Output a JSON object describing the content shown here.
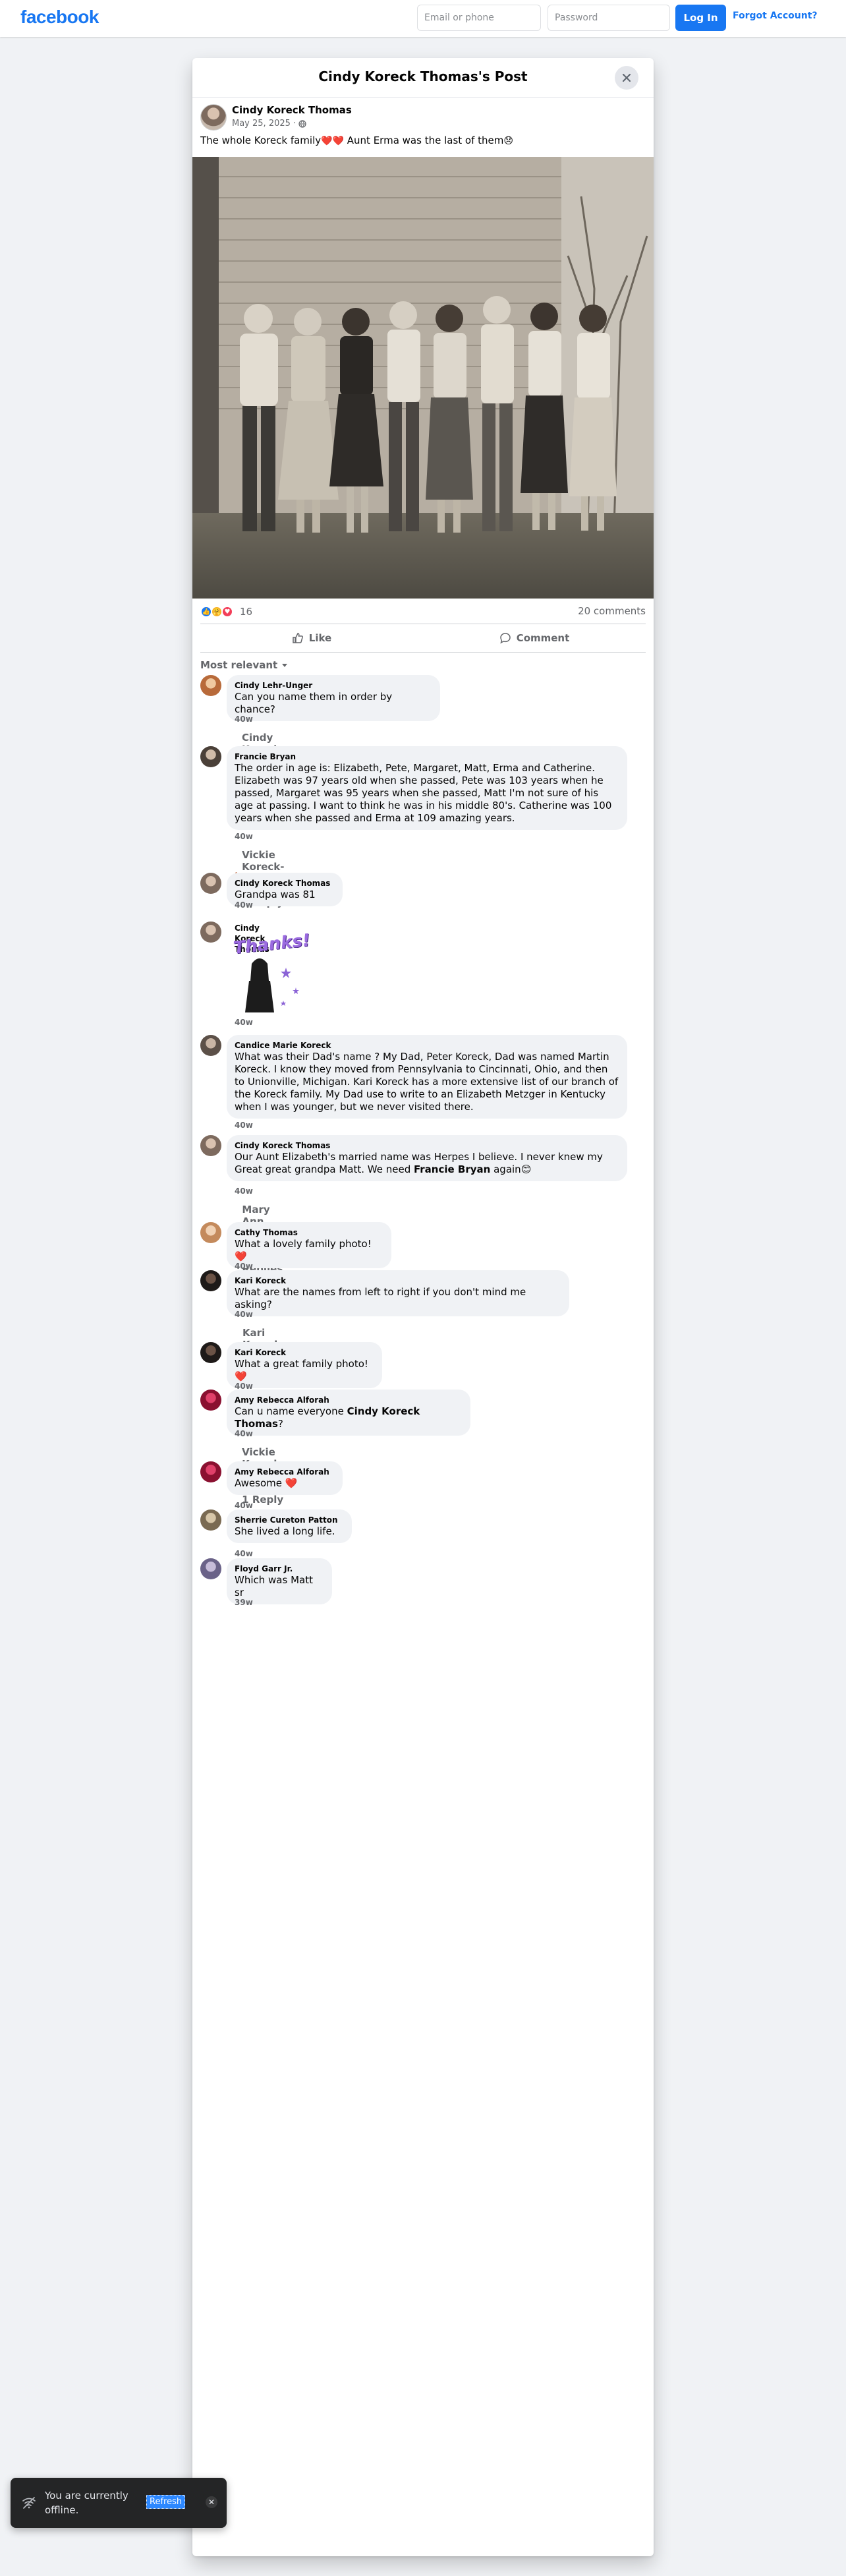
{
  "topbar": {
    "logo": "facebook",
    "email_placeholder": "Email or phone",
    "password_placeholder": "Password",
    "login_label": "Log In",
    "forgot_label": "Forgot Account?"
  },
  "dialog": {
    "title": "Cindy Koreck Thomas's Post",
    "close_icon": "close-icon"
  },
  "post": {
    "author": "Cindy Koreck Thomas",
    "date": "May 25, 2025",
    "audience_icon": "globe-icon",
    "text": "The whole Koreck family",
    "text_emojis": "❤️❤️",
    "text_tail": "Aunt Erma was the last of them",
    "text_tail_emoji": "😞",
    "reaction_count": "16",
    "comments_count": "20 comments",
    "like_label": "Like",
    "comment_label": "Comment",
    "sort_label": "Most relevant"
  },
  "comments": [
    {
      "name": "Cindy Lehr-Unger",
      "text": "Can you name them in order by chance?",
      "time": "40w",
      "reply": "Cindy Koreck Thomas replied · 1 Reply"
    },
    {
      "name": "Francie Bryan",
      "text": "The order in age is: Elizabeth, Pete, Margaret, Matt, Erma and Catherine. Elizabeth was 97 years old when she passed, Pete was 103 years when he passed, Margaret was 95 years when she passed, Matt I'm not sure of his age at passing. I want to think he was in his middle 80's. Catherine was 100 years when she passed and Erma at 109 amazing years.",
      "time": "40w",
      "reply": "Vickie Koreck-Kuhn replied · 1 Reply"
    },
    {
      "name": "Cindy Koreck Thomas",
      "text": "Grandpa was 81",
      "time": "40w"
    },
    {
      "name": "Cindy Koreck Thomas",
      "sticker": "Thanks!",
      "time": "40w"
    },
    {
      "name": "Candice Marie Koreck",
      "text": "What was their Dad's name ? My Dad, Peter Koreck, Dad was named Martin Koreck. I know they moved from Pennsylvania to Cincinnati, Ohio, and then to Unionville, Michigan. Kari Koreck has a more extensive list of our branch of the Koreck family. My Dad use to write to an Elizabeth Metzger in Kentucky when I was younger, but we never visited there.",
      "time": "40w"
    },
    {
      "name": "Cindy Koreck Thomas",
      "text": "Our Aunt Elizabeth's married name was Herpes I believe. I never knew my Great great grandpa Matt. We need",
      "mention": "Francie Bryan",
      "text_after": "again",
      "emoji": "😊",
      "time": "40w",
      "reply": "Mary Ann Gast replied · 2 Replies"
    },
    {
      "name": "Cathy Thomas",
      "text": "What a lovely family photo!",
      "emoji": "❤️",
      "time": "40w"
    },
    {
      "name": "Kari Koreck",
      "text": "What are the names from left to right if you don't mind me asking?",
      "time": "40w",
      "reply": "Kari Koreck replied · 2 Replies"
    },
    {
      "name": "Kari Koreck",
      "text": "What a great family photo!",
      "emoji": "❤️",
      "time": "40w"
    },
    {
      "name": "Amy Rebecca Alforah",
      "text": "Can u name everyone",
      "mention": "Cindy Koreck Thomas",
      "text_after": "?",
      "time": "40w",
      "reply": "Vickie Koreck-Kuhn replied · 1 Reply"
    },
    {
      "name": "Amy Rebecca Alforah",
      "text": "Awesome",
      "emoji": "❤️",
      "time": "40w"
    },
    {
      "name": "Sherrie Cureton Patton",
      "text": "She lived a long life.",
      "time": "40w"
    },
    {
      "name": "Floyd Garr Jr.",
      "text": "Which was Matt sr",
      "time": "39w"
    }
  ],
  "toast": {
    "text": "You are currently offline.",
    "refresh_label": "Refresh",
    "icon": "wifi-off-icon"
  }
}
